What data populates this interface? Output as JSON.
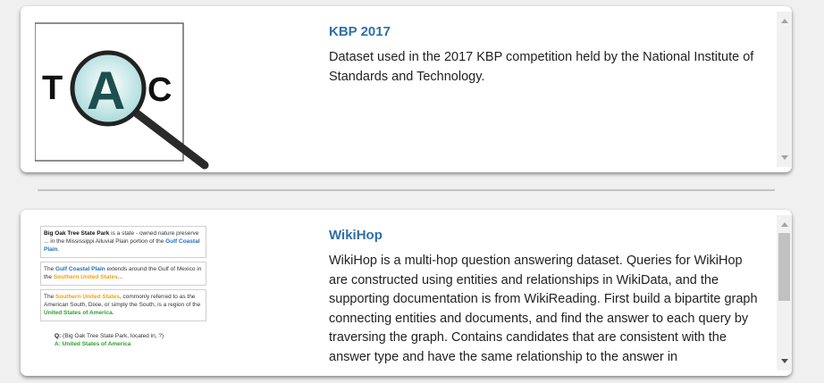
{
  "cards": [
    {
      "title": "KBP 2017",
      "description": "Dataset used in the 2017 KBP competition held by the National Institute of Standards and Technology.",
      "logo_letters": [
        "T",
        "A",
        "C"
      ]
    },
    {
      "title": "WikiHop",
      "description": "WikiHop is a multi-hop question answering dataset. Queries for WikiHop are constructed using entities and relationships in WikiData, and the supporting documentation is from WikiReading. First build a bipartite graph connecting entities and documents, and find the answer to each query by traversing the graph. Contains candidates that are consistent with the answer type and have the same relationship to the answer in",
      "image": {
        "doc1": {
          "entity": "Big Oak Tree State Park",
          "text1": " is a state - owned nature preserve ... in the Mississippi Alluvial Plain portion of the ",
          "link": "Gulf Coastal Plain",
          "text2": "."
        },
        "doc2": {
          "pre": "The ",
          "link1": "Gulf Coastal Plain",
          "mid": " extends around the Gulf of Mexico in the ",
          "link2": "Southern United States",
          "post": "..."
        },
        "doc3": {
          "pre": "The ",
          "link1": "Southern United States",
          "mid": ", commonly referred to as the American South, Dixie, or simply the South, is a region of the ",
          "link2": "United States of America",
          "post": "."
        },
        "query_label": "Q:",
        "query_text": "(Big Oak Tree State Park, located in, ?)",
        "answer_label": "A:",
        "answer_text": "United States of America"
      }
    }
  ],
  "colors": {
    "title": "#2f6fa7",
    "link_blue": "#1f6fc2",
    "link_orange": "#f0a30a",
    "link_green": "#2ca02c"
  }
}
